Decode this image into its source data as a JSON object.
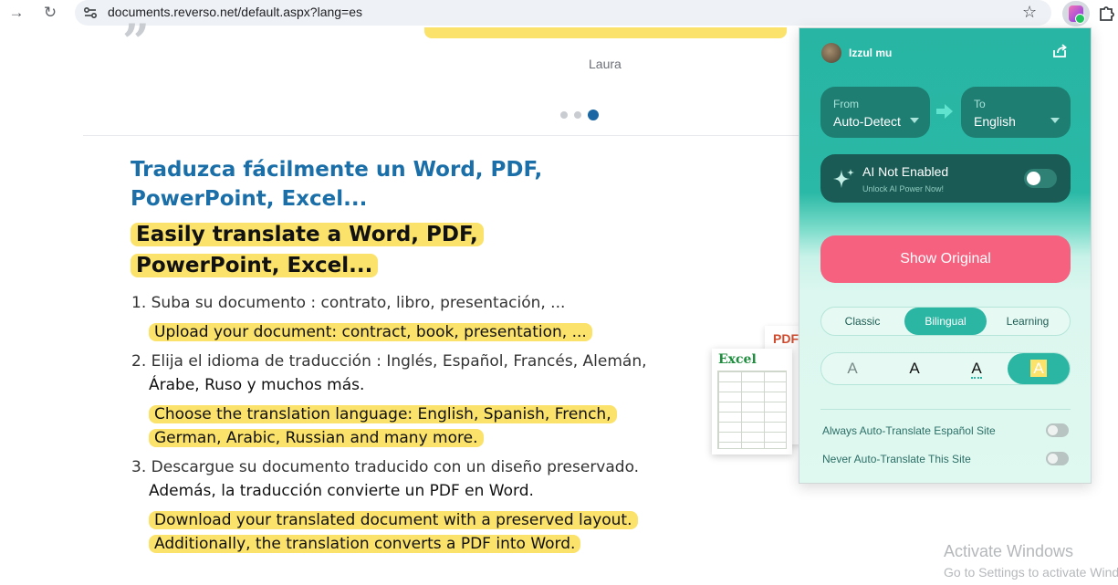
{
  "browser": {
    "url": "documents.reverso.net/default.aspx?lang=es",
    "forward_icon": "arrow-right-icon",
    "reload_icon": "reload-icon"
  },
  "testimonial": {
    "author": "Laura"
  },
  "carousel": {
    "active_index": 2,
    "count": 3
  },
  "section": {
    "heading_es": "Traduzca fácilmente un Word, PDF, PowerPoint, Excel...",
    "heading_en": "Easily translate a Word, PDF, PowerPoint, Excel...",
    "steps": [
      {
        "num": "1.",
        "es": "Suba su documento : contrato, libro, presentación, ...",
        "en": "Upload your document: contract, book, presentation, ..."
      },
      {
        "num": "2.",
        "es_line1": "Elija el idioma de traducción : Inglés, Español, Francés, Alemán,",
        "es_line2": "Árabe, Ruso y muchos más.",
        "en_line1": "Choose the translation language: English, Spanish, French,",
        "en_line2": "German, Arabic, Russian and many more."
      },
      {
        "num": "3.",
        "es_line1": "Descargue su documento traducido con un diseño preservado.",
        "es_line2": "Además, la traducción convierte un PDF en Word.",
        "en_line1": "Download your translated document with a preserved layout.",
        "en_line2": "Additionally, the translation converts a PDF into Word."
      }
    ],
    "file_icons": {
      "pdf": "PDF",
      "excel": "Excel"
    }
  },
  "popup": {
    "user_name": "Izzul mu",
    "from_caption": "From",
    "from_value": "Auto-Detect",
    "to_caption": "To",
    "to_value": "English",
    "ai_title": "AI Not Enabled",
    "ai_subtitle": "Unlock AI Power Now!",
    "show_original": "Show Original",
    "modes": [
      "Classic",
      "Bilingual",
      "Learning"
    ],
    "active_mode": "Bilingual",
    "style_letter": "A",
    "option_1": "Always Auto-Translate Español Site",
    "option_2": "Never Auto-Translate This Site",
    "colors": {
      "accent": "#2bb5a3",
      "button": "#f5617f",
      "highlight": "#fbe26a"
    }
  },
  "watermark": {
    "title": "Activate Windows",
    "subtitle": "Go to Settings to activate Windows."
  }
}
